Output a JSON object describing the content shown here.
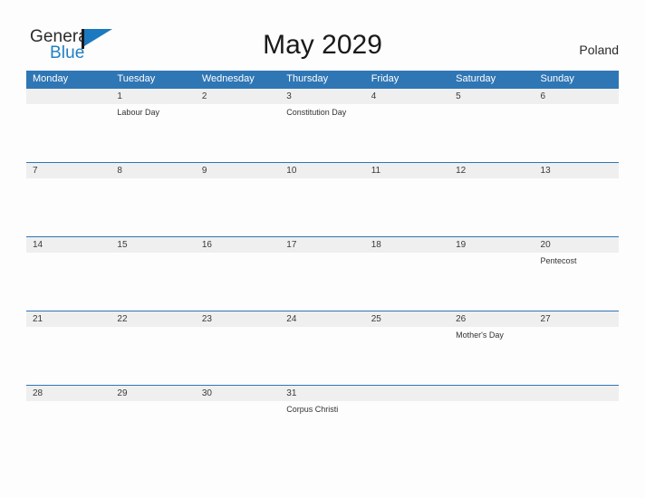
{
  "brand": {
    "name_part1": "General",
    "name_part2": "Blue",
    "logo_icon": "flag-pennant-icon"
  },
  "header": {
    "title": "May 2029",
    "country": "Poland"
  },
  "calendar": {
    "weekday_headers": [
      "Monday",
      "Tuesday",
      "Wednesday",
      "Thursday",
      "Friday",
      "Saturday",
      "Sunday"
    ],
    "colors": {
      "header_blue": "#2f76b5",
      "date_strip_gray": "#efefef",
      "brand_blue": "#1f7fc4",
      "text_dark": "#1a1a1a"
    },
    "weeks": [
      {
        "days": [
          {
            "num": "",
            "event": ""
          },
          {
            "num": "1",
            "event": "Labour Day"
          },
          {
            "num": "2",
            "event": ""
          },
          {
            "num": "3",
            "event": "Constitution Day"
          },
          {
            "num": "4",
            "event": ""
          },
          {
            "num": "5",
            "event": ""
          },
          {
            "num": "6",
            "event": ""
          }
        ]
      },
      {
        "days": [
          {
            "num": "7",
            "event": ""
          },
          {
            "num": "8",
            "event": ""
          },
          {
            "num": "9",
            "event": ""
          },
          {
            "num": "10",
            "event": ""
          },
          {
            "num": "11",
            "event": ""
          },
          {
            "num": "12",
            "event": ""
          },
          {
            "num": "13",
            "event": ""
          }
        ]
      },
      {
        "days": [
          {
            "num": "14",
            "event": ""
          },
          {
            "num": "15",
            "event": ""
          },
          {
            "num": "16",
            "event": ""
          },
          {
            "num": "17",
            "event": ""
          },
          {
            "num": "18",
            "event": ""
          },
          {
            "num": "19",
            "event": ""
          },
          {
            "num": "20",
            "event": "Pentecost"
          }
        ]
      },
      {
        "days": [
          {
            "num": "21",
            "event": ""
          },
          {
            "num": "22",
            "event": ""
          },
          {
            "num": "23",
            "event": ""
          },
          {
            "num": "24",
            "event": ""
          },
          {
            "num": "25",
            "event": ""
          },
          {
            "num": "26",
            "event": "Mother's Day"
          },
          {
            "num": "27",
            "event": ""
          }
        ]
      },
      {
        "days": [
          {
            "num": "28",
            "event": ""
          },
          {
            "num": "29",
            "event": ""
          },
          {
            "num": "30",
            "event": ""
          },
          {
            "num": "31",
            "event": "Corpus Christi"
          },
          {
            "num": "",
            "event": ""
          },
          {
            "num": "",
            "event": ""
          },
          {
            "num": "",
            "event": ""
          }
        ]
      }
    ]
  }
}
